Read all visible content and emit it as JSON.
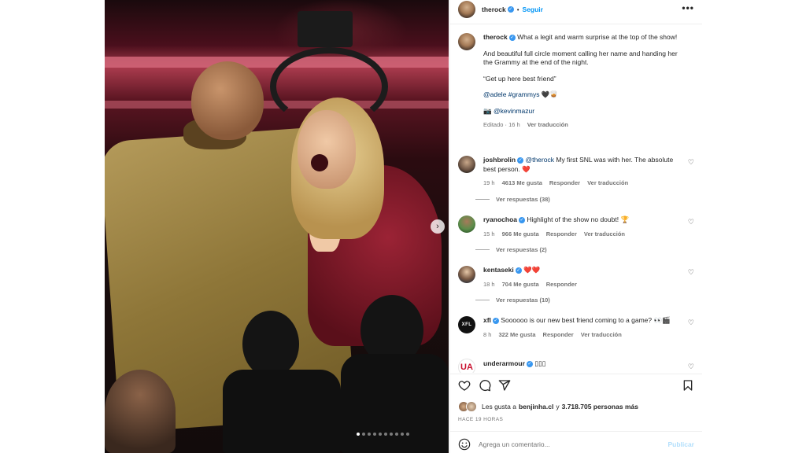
{
  "post": {
    "username": "therock",
    "verified_mark": "✓",
    "follow_label": "Seguir",
    "header_dot": "•",
    "more_label": "•••"
  },
  "caption": {
    "username": "therock",
    "line1": "What a legit and warm surprise at the top of the show!",
    "line2": "And beautiful full circle moment calling her name and handing her the Grammy at the end of the night.",
    "line3": "“Get up here best friend”",
    "tags": "@adele #grammys",
    "tags_emoji": "🖤🥃",
    "credit_emoji": "📷",
    "credit": "@kevinmazur",
    "meta_time": "Editado · 16 h",
    "meta_translate": "Ver traducción"
  },
  "comments": [
    {
      "username": "joshbrolin",
      "mention": "@therock",
      "text": "My first SNL was with her. The absolute best person.",
      "emoji": "❤️",
      "time": "19 h",
      "likes": "4613 Me gusta",
      "reply": "Responder",
      "translate": "Ver traducción",
      "replies": "Ver respuestas (38)"
    },
    {
      "username": "ryanochoa",
      "text": "Highlight of the show no doubt!",
      "emoji": "🏆",
      "time": "15 h",
      "likes": "966 Me gusta",
      "reply": "Responder",
      "translate": "Ver traducción",
      "replies": "Ver respuestas (2)"
    },
    {
      "username": "kentaseki",
      "text": "",
      "emoji": "❤️❤️",
      "time": "18 h",
      "likes": "704 Me gusta",
      "reply": "Responder",
      "replies": "Ver respuestas (10)"
    },
    {
      "username": "xfl",
      "avatar_text": "XFL",
      "text": "Soooooo is our new best friend coming to a game?",
      "emoji": "👀🎬",
      "time": "8 h",
      "likes": "322 Me gusta",
      "reply": "Responder",
      "translate": "Ver traducción"
    },
    {
      "username": "underarmour",
      "avatar_text": "UA",
      "text": "",
      "emoji": "▯▯▯"
    }
  ],
  "likes": {
    "prefix": "Les gusta a",
    "user": "benjinha.cl",
    "middle": "y",
    "count": "3.718.705 personas más"
  },
  "time_label": "HACE 19 HORAS",
  "comment_box": {
    "placeholder": "Agrega un comentario...",
    "publish_label": "Publicar"
  },
  "photo": {
    "next_label": "›",
    "slide_count": 10,
    "active_slide": 1
  },
  "icons": {
    "like": "heart-icon",
    "comment": "comment-icon",
    "share": "share-icon",
    "save": "bookmark-icon",
    "emoji": "emoji-icon",
    "more": "more-icon"
  },
  "colors": {
    "link_blue": "#0095f6",
    "verified_blue": "#3897f0",
    "mention": "#00376b",
    "muted": "#737373",
    "heart_red": "#e0245e",
    "publish_disabled": "#b2dffc"
  }
}
